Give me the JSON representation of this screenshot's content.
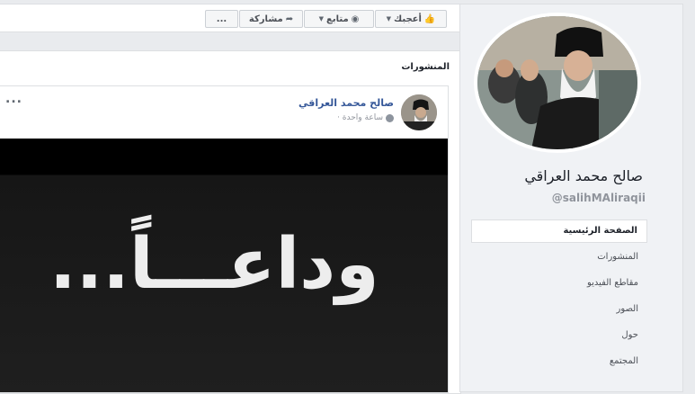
{
  "action_bar": {
    "like_label": "أعجبك",
    "follow_label": "متابع",
    "share_label": "مشاركة",
    "more_label": "..."
  },
  "posts": {
    "title": "المنشورات",
    "post": {
      "author": "صالح محمد العراقي",
      "time": "ساعة واحدة ·",
      "more_label": "...",
      "image_text": "وداعـــاً..."
    }
  },
  "profile": {
    "name": "صالح محمد العراقي",
    "handle": "@salihMAliraqii",
    "nav": [
      {
        "label": "الصفحة الرئيسية"
      },
      {
        "label": "المنشورات"
      },
      {
        "label": "مقاطع الفيديو"
      },
      {
        "label": "الصور"
      },
      {
        "label": "حول"
      },
      {
        "label": "المجتمع"
      }
    ]
  },
  "colors": {
    "link": "#365899",
    "like": "#4267b2",
    "background": "#e9ebee"
  }
}
